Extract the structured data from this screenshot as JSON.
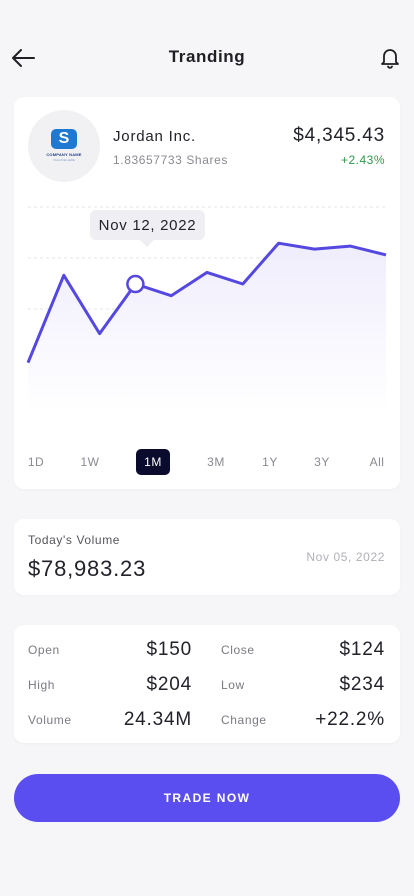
{
  "header": {
    "title": "Tranding",
    "back_icon": "arrow-left-icon",
    "notification_icon": "bell-icon"
  },
  "stock": {
    "company_name": "Jordan Inc.",
    "shares": "1.83657733 Shares",
    "price": "$4,345.43",
    "change": "+2.43%",
    "logo": {
      "letter": "S",
      "name": "COMPANY NAME",
      "tagline": "TAGLINE HERE"
    }
  },
  "chart": {
    "tooltip_date": "Nov 12, 2022",
    "line_color": "#5548e0",
    "fill_color": "#efedfc"
  },
  "chart_data": {
    "type": "area",
    "values": [
      20,
      50,
      30,
      47,
      43,
      51,
      47,
      61,
      59,
      60,
      57
    ],
    "ylim": [
      0,
      70
    ],
    "highlight_index": 3,
    "grid": true
  },
  "range_tabs": [
    "1D",
    "1W",
    "1M",
    "3M",
    "1Y",
    "3Y",
    "All"
  ],
  "active_tab": "1M",
  "volume": {
    "label": "Today's Volume",
    "value": "$78,983.23",
    "date": "Nov 05, 2022"
  },
  "stats": {
    "open_label": "Open",
    "open_value": "$150",
    "close_label": "Close",
    "close_value": "$124",
    "high_label": "High",
    "high_value": "$204",
    "low_label": "Low",
    "low_value": "$234",
    "volume_label": "Volume",
    "volume_value": "24.34M",
    "change_label": "Change",
    "change_value": "+22.2%"
  },
  "cta": {
    "label": "TRADE NOW",
    "color": "#5b4ef0"
  }
}
